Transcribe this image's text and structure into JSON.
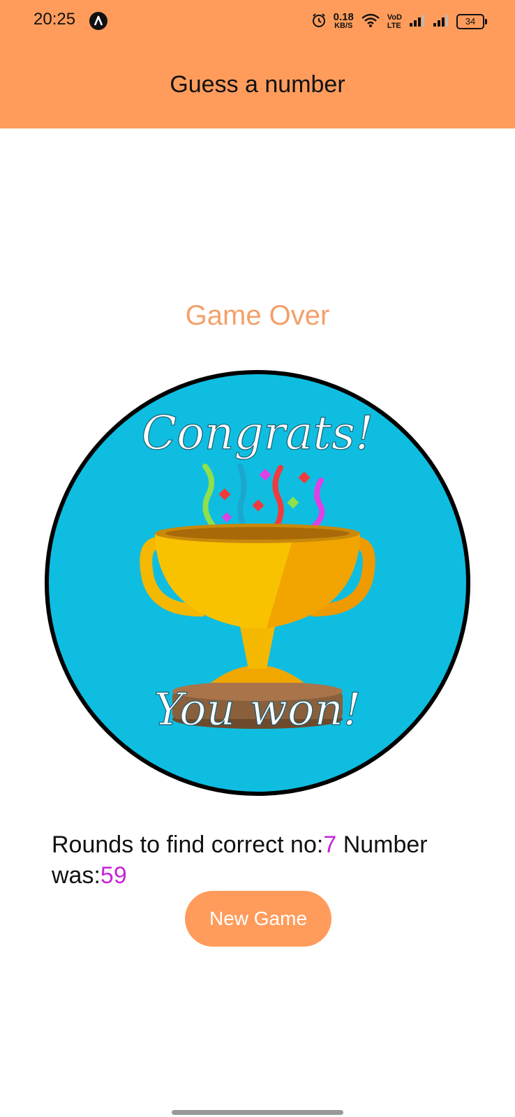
{
  "status_bar": {
    "time": "20:25",
    "net_speed_value": "0.18",
    "net_speed_unit": "KB/S",
    "volte_top": "VoD",
    "volte_bottom": "LTE",
    "battery_level": "34",
    "icons": [
      "app-notification-icon",
      "alarm-icon",
      "wifi-icon",
      "signal-icon",
      "signal-icon",
      "battery-icon"
    ]
  },
  "header": {
    "title": "Guess a number",
    "background_color": "#ff9c5c"
  },
  "main": {
    "heading": "Game Over",
    "heading_color": "#f4a06a",
    "image": {
      "top_text": "Congrats!",
      "bottom_text": "You won!"
    },
    "result": {
      "rounds_label": "Rounds to find correct no:",
      "rounds_value": "7",
      "number_label": " Number was:",
      "number_value": "59",
      "highlight_color": "#c526d8"
    },
    "new_game_label": "New Game"
  }
}
